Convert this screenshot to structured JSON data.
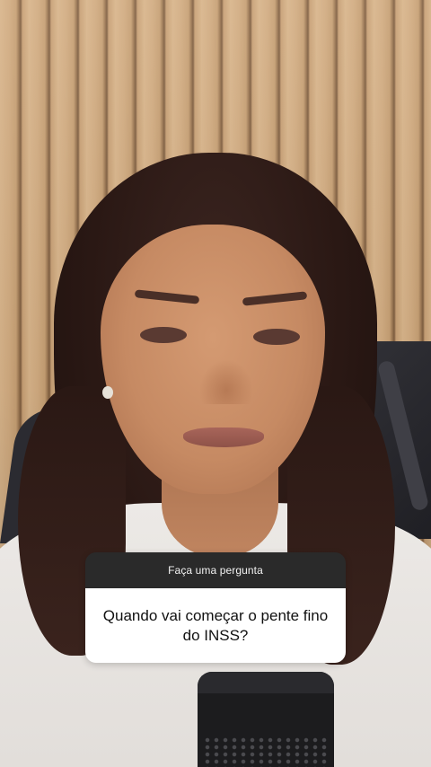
{
  "question_sticker": {
    "header": "Faça uma pergunta",
    "question": "Quando vai começar o pente fino do INSS?"
  },
  "colors": {
    "sticker_header_bg": "#2a2a2a",
    "sticker_body_bg": "#ffffff",
    "wall": "#d1ab80"
  }
}
